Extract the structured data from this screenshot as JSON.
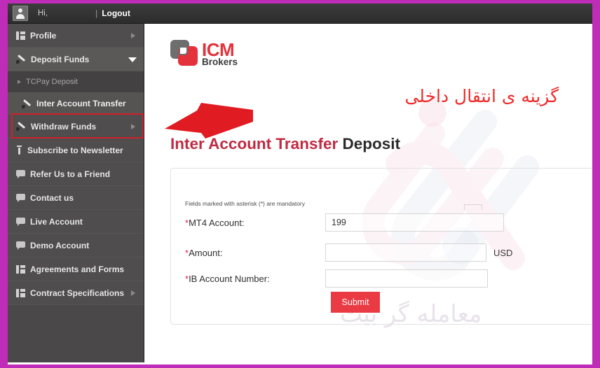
{
  "frame": {
    "border_color": "#bf2cb8"
  },
  "topbar": {
    "avatar_icon": "user-icon",
    "greeting": "Hi,",
    "username": "",
    "separator": "|",
    "logout_label": "Logout"
  },
  "sidebar": {
    "items": [
      {
        "label": "Profile",
        "icon": "columns-icon",
        "caret": "right",
        "level": "top"
      },
      {
        "label": "Deposit Funds",
        "icon": "brush-icon",
        "caret": "down",
        "level": "top",
        "state": "expanded"
      },
      {
        "label": "TCPay Deposit",
        "icon": "caret-right-icon",
        "level": "sub"
      },
      {
        "label": "Inter Account Transfer",
        "icon": "brush-icon",
        "level": "sub",
        "state": "selected",
        "highlighted": true
      },
      {
        "label": "Withdraw Funds",
        "icon": "brush-icon",
        "caret": "right",
        "level": "top"
      },
      {
        "label": "Subscribe to Newsletter",
        "icon": "flask-icon",
        "level": "top"
      },
      {
        "label": "Refer Us to a Friend",
        "icon": "bubble-icon",
        "level": "top"
      },
      {
        "label": "Contact us",
        "icon": "bubble-icon",
        "level": "top"
      },
      {
        "label": "Live Account",
        "icon": "bubble-icon",
        "level": "top"
      },
      {
        "label": "Demo Account",
        "icon": "bubble-icon",
        "level": "top"
      },
      {
        "label": "Agreements and Forms",
        "icon": "columns-icon",
        "level": "top"
      },
      {
        "label": "Contract Specifications",
        "icon": "columns-icon",
        "caret": "right",
        "level": "top"
      }
    ],
    "highlight_color": "#d0202a"
  },
  "main": {
    "logo": {
      "brand": "ICM",
      "subbrand": "Brokers",
      "brand_color": "#e3323c",
      "subbrand_color": "#3b3b3b"
    },
    "annotation": {
      "arrow_icon": "left-arrow-icon",
      "arrow_color": "#e01b22",
      "text": "گزینه ی انتقال داخلی",
      "text_color": "#ef2b2b"
    },
    "heading": {
      "highlight": "Inter Account Transfer",
      "highlight_color": "#c02a42",
      "rest": " Deposit",
      "rest_color": "#2a2a2a"
    },
    "form": {
      "mandatory_note": "Fields marked with asterisk (*) are mandatory",
      "fields": [
        {
          "label": "*MT4 Account:",
          "value": "199",
          "placeholder": "",
          "suffix": ""
        },
        {
          "label": "*Amount:",
          "value": "",
          "placeholder": "",
          "suffix": "USD"
        },
        {
          "label": "*IB Account Number:",
          "value": "",
          "placeholder": "",
          "suffix": ""
        }
      ],
      "submit_label": "Submit",
      "submit_color": "#ea3b45"
    },
    "watermark": {
      "text": "معامله گر بیت",
      "logo_icon": "brand-watermark-icon"
    }
  }
}
